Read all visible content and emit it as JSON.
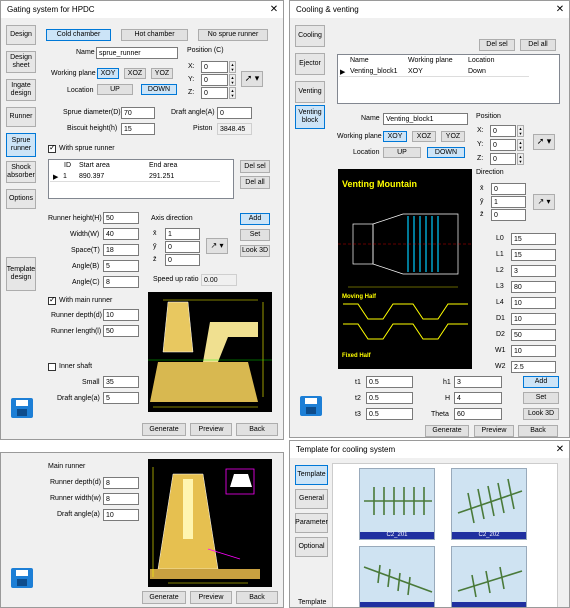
{
  "w1": {
    "title": "Gating system for HPDC",
    "side": [
      "Design",
      "Design sheet",
      "Ingate design",
      "Runner",
      "Sprue runner",
      "Shock absorber",
      "Options",
      "Template design"
    ],
    "tabs": [
      "Cold chamber",
      "Hot chamber",
      "No sprue runner"
    ],
    "name_label": "Name",
    "name_value": "sprue_runner",
    "position_label": "Position (C)",
    "wp_label": "Working plane",
    "wp": [
      "XOY",
      "XOZ",
      "YOZ"
    ],
    "loc_label": "Location",
    "loc": [
      "UP",
      "DOWN"
    ],
    "px": "X:",
    "py": "Y:",
    "pz": "Z:",
    "pv": [
      "0",
      "0",
      "0"
    ],
    "sd_label": "Sprue diameter(D)",
    "sd": "70",
    "da_label": "Draft angle(A)",
    "da": "0",
    "bh_label": "Biscuit height(h)",
    "bh": "15",
    "piston_label": "Piston",
    "piston": "3848.45",
    "with_sprue": "With sprue runner",
    "cols": [
      "ID",
      "Start area",
      "End area"
    ],
    "row": [
      "1",
      "890.397",
      "291.251"
    ],
    "del_sel": "Del sel",
    "del_all": "Del all",
    "fields": [
      {
        "l": "Runner height(H)",
        "v": "50"
      },
      {
        "l": "Width(W)",
        "v": "40"
      },
      {
        "l": "Space(T)",
        "v": "18"
      },
      {
        "l": "Angle(B)",
        "v": "5"
      },
      {
        "l": "Angle(C)",
        "v": "8"
      }
    ],
    "axis_label": "Axis direction",
    "axis": [
      "1",
      "0",
      "0"
    ],
    "add": "Add",
    "set": "Set",
    "look": "Look 3D",
    "speed_label": "Speed up ratio",
    "speed": "0.00",
    "with_main": "With main runner",
    "rd_label": "Runner depth(d)",
    "rd": "10",
    "rl_label": "Runner length(l)",
    "rl": "50",
    "inner": "Inner shaft",
    "small_label": "Small",
    "small": "35",
    "da2_label": "Draft angle(a)",
    "da2": "5",
    "gen": "Generate",
    "prev": "Preview",
    "back": "Back"
  },
  "w2": {
    "title": "Cooling & venting",
    "side": [
      "Cooling",
      "Ejector",
      "Venting",
      "Venting block"
    ],
    "del_sel": "Del sel",
    "del_all": "Del all",
    "cols": [
      "Name",
      "Working plane",
      "Location"
    ],
    "row": [
      "Venting_block1",
      "XOY",
      "Down"
    ],
    "name_label": "Name",
    "name_value": "Venting_block1",
    "position_label": "Position",
    "wp_label": "Working plane",
    "wp": [
      "XOY",
      "XOZ",
      "YOZ"
    ],
    "loc_label": "Location",
    "loc": [
      "UP",
      "DOWN"
    ],
    "px": "X:",
    "py": "Y:",
    "pz": "Z:",
    "pv": [
      "0",
      "0",
      "0"
    ],
    "dir_label": "Direction",
    "dir": [
      "0",
      "1",
      "0"
    ],
    "img_title": "Venting Mountain",
    "img_moving": "Moving Half",
    "img_fixed": "Fixed Half",
    "params": [
      {
        "l": "L0",
        "v": "15"
      },
      {
        "l": "L1",
        "v": "15"
      },
      {
        "l": "L2",
        "v": "3"
      },
      {
        "l": "L3",
        "v": "80"
      },
      {
        "l": "L4",
        "v": "10"
      },
      {
        "l": "D1",
        "v": "10"
      },
      {
        "l": "D2",
        "v": "50"
      },
      {
        "l": "W1",
        "v": "10"
      },
      {
        "l": "W2",
        "v": "2.5"
      }
    ],
    "t1_label": "t1",
    "t1": "0.5",
    "t2_label": "t2",
    "t2": "0.5",
    "t3_label": "t3",
    "t3": "0.5",
    "h1_label": "h1",
    "h1": "3",
    "H_label": "H",
    "H": "4",
    "theta_label": "Theta",
    "theta": "60",
    "add": "Add",
    "set": "Set",
    "look": "Look 3D",
    "gen": "Generate",
    "prev": "Preview",
    "back": "Back"
  },
  "w3": {
    "title": "Main runner",
    "rd_label": "Runner depth(d)",
    "rd": "8",
    "rw_label": "Runner width(w)",
    "rw": "8",
    "da_label": "Draft angle(a)",
    "da": "10",
    "gen": "Generate",
    "prev": "Preview",
    "back": "Back"
  },
  "w4": {
    "title": "Template for cooling system",
    "side": [
      "Template",
      "General",
      "Parameter",
      "Optional"
    ],
    "foot": "Template",
    "tiles": [
      "C2_201",
      "C2_202",
      "",
      ""
    ]
  }
}
